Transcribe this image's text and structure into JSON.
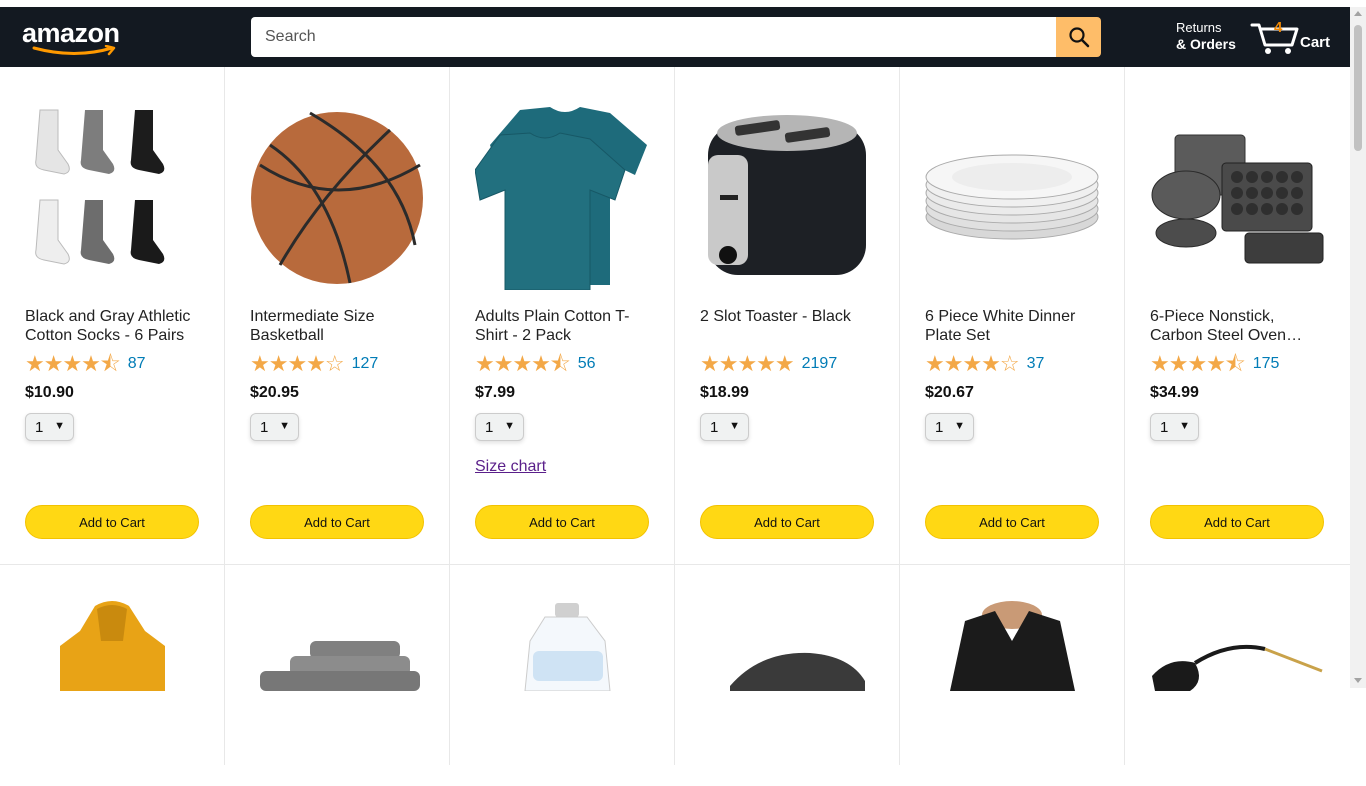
{
  "header": {
    "logo_text": "amazon",
    "search": {
      "placeholder": "Search",
      "icon": "search-icon"
    },
    "returns": {
      "line1": "Returns",
      "line2": "& Orders"
    },
    "cart": {
      "count": "4",
      "label": "Cart",
      "icon": "cart-icon"
    }
  },
  "colors": {
    "header_bg": "#131921",
    "search_button": "#febd69",
    "add_to_cart": "#ffd814",
    "stars": "#f3a847",
    "rating_count": "#017cb6",
    "cart_count": "#f08804"
  },
  "products": [
    {
      "name": "Black and Gray Athletic Cotton Socks - 6 Pairs",
      "rating": 4.5,
      "stars": "★★★★⯪",
      "rating_count": "87",
      "price": "$10.90",
      "qty": "1",
      "button": "Add to Cart",
      "image": "socks-image"
    },
    {
      "name": "Intermediate Size Basketball",
      "rating": 4.0,
      "stars": "★★★★☆",
      "rating_count": "127",
      "price": "$20.95",
      "qty": "1",
      "button": "Add to Cart",
      "image": "basketball-image"
    },
    {
      "name": "Adults Plain Cotton T-Shirt - 2 Pack",
      "rating": 4.5,
      "stars": "★★★★⯪",
      "rating_count": "56",
      "price": "$7.99",
      "qty": "1",
      "button": "Add to Cart",
      "link": "Size chart",
      "image": "tshirt-image"
    },
    {
      "name": "2 Slot Toaster - Black",
      "rating": 5.0,
      "stars": "★★★★★",
      "rating_count": "2197",
      "price": "$18.99",
      "qty": "1",
      "button": "Add to Cart",
      "image": "toaster-image"
    },
    {
      "name": "6 Piece White Dinner Plate Set",
      "rating": 4.0,
      "stars": "★★★★☆",
      "rating_count": "37",
      "price": "$20.67",
      "qty": "1",
      "button": "Add to Cart",
      "image": "plates-image"
    },
    {
      "name": "6-Piece Nonstick, Carbon Steel Oven…",
      "rating": 4.5,
      "stars": "★★★★⯪",
      "rating_count": "175",
      "price": "$34.99",
      "qty": "1",
      "button": "Add to Cart",
      "image": "bakeware-image"
    }
  ],
  "second_row_images": [
    "hoodie-image",
    "towels-image",
    "detergent-image",
    "sneaker-image",
    "blouse-image",
    "sunglasses-image"
  ]
}
